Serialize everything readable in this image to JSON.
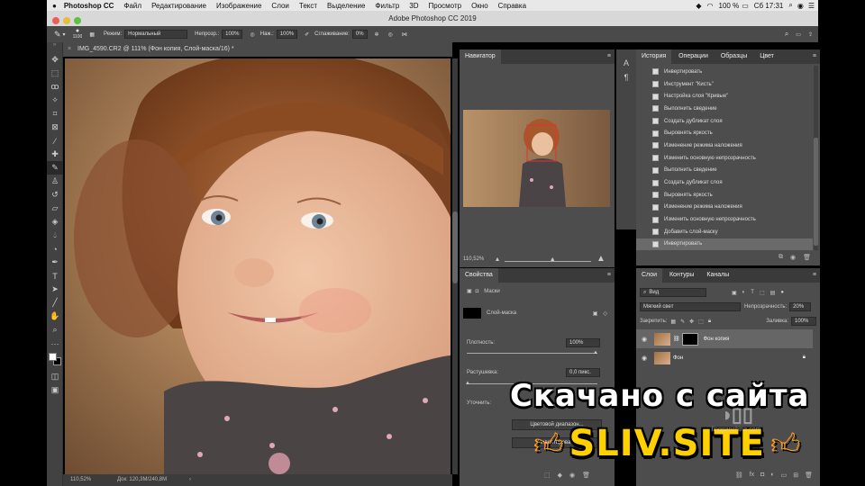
{
  "menubar": {
    "app": "Photoshop CC",
    "items": [
      "Файл",
      "Редактирование",
      "Изображение",
      "Слои",
      "Текст",
      "Выделение",
      "Фильтр",
      "3D",
      "Просмотр",
      "Окно",
      "Справка"
    ],
    "battery": "100 %",
    "clock": "Сб 17:31"
  },
  "window_title": "Adobe Photoshop CC 2019",
  "options": {
    "brush_size": "1100",
    "mode_label": "Режим:",
    "mode_value": "Нормальный",
    "opacity_label": "Непрозр.:",
    "opacity_value": "100%",
    "flow_label": "Наж.:",
    "flow_value": "100%",
    "smoothing_label": "Сглаживание:",
    "smoothing_value": "0%"
  },
  "document": {
    "tab_title": "IMG_4590.CR2 @ 111% (Фон копия, Слой-маска/16) *",
    "zoom": "110,52%",
    "doc_size": "Док: 120,3M/240,8M"
  },
  "navigator": {
    "title": "Навигатор",
    "zoom": "110,52%",
    "zoom_level": 0.55
  },
  "properties": {
    "title": "Свойства",
    "section": "Маски",
    "mask_label": "Слой-маска",
    "density_label": "Плотность:",
    "density_value": "100%",
    "feather_label": "Растушевка:",
    "feather_value": "0,0 пикс.",
    "refine_label": "Уточнить:",
    "btn_color_range": "Цветовой диапазон...",
    "btn_invert": "Инвертировать"
  },
  "history": {
    "tabs": [
      "История",
      "Операции",
      "Образцы",
      "Цвет"
    ],
    "items": [
      "Инвертировать",
      "Инструмент \"Кисть\"",
      "Настройка слоя \"Кривые\"",
      "Выполнить сведение",
      "Создать дубликат слоя",
      "Выровнять яркость",
      "Изменение режима наложения",
      "Изменить основную непрозрачность",
      "Выполнить сведение",
      "Создать дубликат слоя",
      "Выровнять яркость",
      "Изменение режима наложения",
      "Изменить основную непрозрачность",
      "Добавить слой-маску",
      "Инвертировать"
    ],
    "selected_index": 14
  },
  "layers": {
    "tabs": [
      "Слои",
      "Контуры",
      "Каналы"
    ],
    "filter": "Вид",
    "blend_mode": "Мягкий свет",
    "opacity_label": "Непрозрачность:",
    "opacity_value": "20%",
    "lock_label": "Закрепить:",
    "fill_label": "Заливка:",
    "fill_value": "100%",
    "rows": [
      {
        "name": "Фон копия"
      },
      {
        "name": "Фон"
      }
    ]
  },
  "watermark": {
    "line1": "Скачано с сайта",
    "line2": "SLIV.SITE",
    "logo_text": "lingganchina.com"
  },
  "colors": {
    "accent": "#ffd000",
    "panel": "#4d4d4d",
    "panel_dark": "#3a3a3a"
  }
}
